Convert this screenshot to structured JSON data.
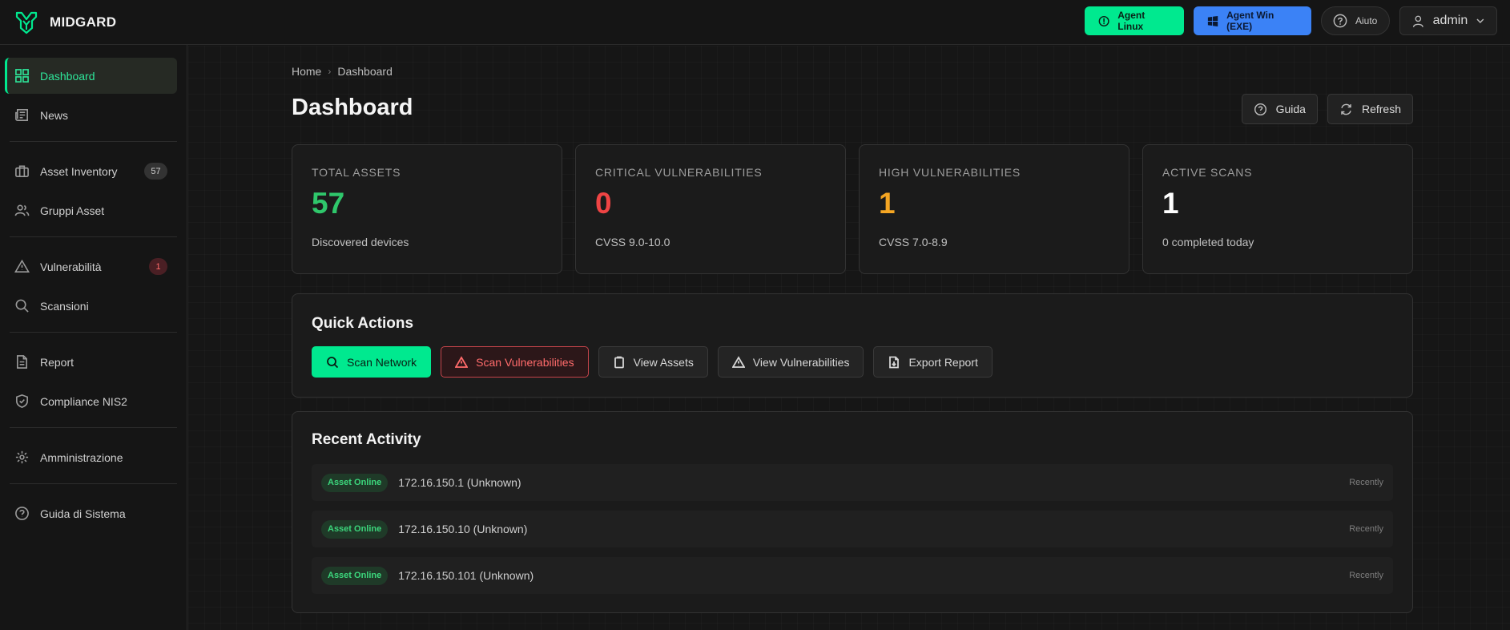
{
  "app": {
    "name": "MIDGARD"
  },
  "topbar": {
    "agent_linux": "Agent Linux",
    "agent_win": "Agent Win (EXE)",
    "help": "Aiuto",
    "user": "admin"
  },
  "sidebar": {
    "items": [
      {
        "label": "Dashboard",
        "icon": "grid-icon"
      },
      {
        "label": "News",
        "icon": "newspaper-icon"
      },
      {
        "label": "Asset Inventory",
        "icon": "briefcase-icon",
        "badge": "57"
      },
      {
        "label": "Gruppi Asset",
        "icon": "users-icon"
      },
      {
        "label": "Vulnerabilità",
        "icon": "warning-icon",
        "badge": "1"
      },
      {
        "label": "Scansioni",
        "icon": "search-icon"
      },
      {
        "label": "Report",
        "icon": "file-icon"
      },
      {
        "label": "Compliance NIS2",
        "icon": "shield-icon"
      },
      {
        "label": "Amministrazione",
        "icon": "gear-icon"
      },
      {
        "label": "Guida di Sistema",
        "icon": "help-icon"
      }
    ]
  },
  "breadcrumb": {
    "home": "Home",
    "current": "Dashboard"
  },
  "page": {
    "title": "Dashboard",
    "guide": "Guida",
    "refresh": "Refresh"
  },
  "stats": [
    {
      "label": "TOTAL ASSETS",
      "value": "57",
      "sub": "Discovered devices",
      "color": "#2fc76b"
    },
    {
      "label": "CRITICAL VULNERABILITIES",
      "value": "0",
      "sub": "CVSS 9.0-10.0",
      "color": "#ef4444"
    },
    {
      "label": "HIGH VULNERABILITIES",
      "value": "1",
      "sub": "CVSS 7.0-8.9",
      "color": "#f5a623"
    },
    {
      "label": "ACTIVE SCANS",
      "value": "1",
      "sub": "0 completed today",
      "color": "#ffffff"
    }
  ],
  "quick_actions": {
    "title": "Quick Actions",
    "scan_network": "Scan Network",
    "scan_vulns": "Scan Vulnerabilities",
    "view_assets": "View Assets",
    "view_vulns": "View Vulnerabilities",
    "export_report": "Export Report"
  },
  "recent_activity": {
    "title": "Recent Activity",
    "items": [
      {
        "badge": "Asset Online",
        "text": "172.16.150.1 (Unknown)",
        "time": "Recently"
      },
      {
        "badge": "Asset Online",
        "text": "172.16.150.10 (Unknown)",
        "time": "Recently"
      },
      {
        "badge": "Asset Online",
        "text": "172.16.150.101 (Unknown)",
        "time": "Recently"
      }
    ]
  },
  "colors": {
    "accent": "#00e98f",
    "windows": "#3b82f6",
    "danger": "#ef4444"
  }
}
